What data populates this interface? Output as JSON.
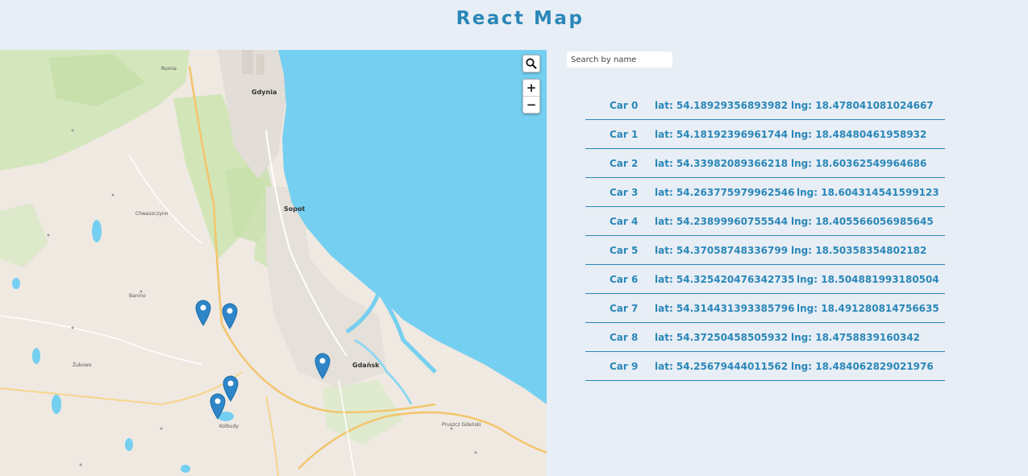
{
  "app": {
    "title": "React Map"
  },
  "search": {
    "placeholder": "Search by name",
    "value": ""
  },
  "map": {
    "controls": {
      "search_icon": "magnifier-icon",
      "zoom_in": "+",
      "zoom_out": "−"
    },
    "labels": {
      "gdynia": "Gdynia",
      "sopot": "Sopot",
      "gdansk": "Gdańsk",
      "zukowo": "Żukowo",
      "pruszcz": "Pruszcz Gdański",
      "kolbudy": "Kolbudy",
      "banino": "Banino",
      "chwaszczyno": "Chwaszczyno",
      "rumia": "Rumia"
    },
    "marker_icon": "map-pin-icon",
    "colors": {
      "water": "#75cff0",
      "land": "#efe9e2",
      "forest": "#cde4b3",
      "marker": "#2e86c9"
    }
  },
  "cars": [
    {
      "name": "Car 0",
      "lat": "lat: 54.18929356893982",
      "lng": "lng: 18.478041081024667"
    },
    {
      "name": "Car 1",
      "lat": "lat: 54.18192396961744",
      "lng": "lng: 18.48480461958932"
    },
    {
      "name": "Car 2",
      "lat": "lat: 54.33982089366218",
      "lng": "lng: 18.60362549964686"
    },
    {
      "name": "Car 3",
      "lat": "lat: 54.263775979962546",
      "lng": "lng: 18.604314541599123"
    },
    {
      "name": "Car 4",
      "lat": "lat: 54.23899960755544",
      "lng": "lng: 18.405566056985645"
    },
    {
      "name": "Car 5",
      "lat": "lat: 54.37058748336799",
      "lng": "lng: 18.50358354802182"
    },
    {
      "name": "Car 6",
      "lat": "lat: 54.325420476342735",
      "lng": "lng: 18.504881993180504"
    },
    {
      "name": "Car 7",
      "lat": "lat: 54.314431393385796",
      "lng": "lng: 18.491280814756635"
    },
    {
      "name": "Car 8",
      "lat": "lat: 54.37250458505932",
      "lng": "lng: 18.4758839160342"
    },
    {
      "name": "Car 9",
      "lat": "lat: 54.25679444011562",
      "lng": "lng: 18.484062829021976"
    }
  ],
  "colors": {
    "accent": "#2a87b8",
    "background": "#e8eef5"
  }
}
